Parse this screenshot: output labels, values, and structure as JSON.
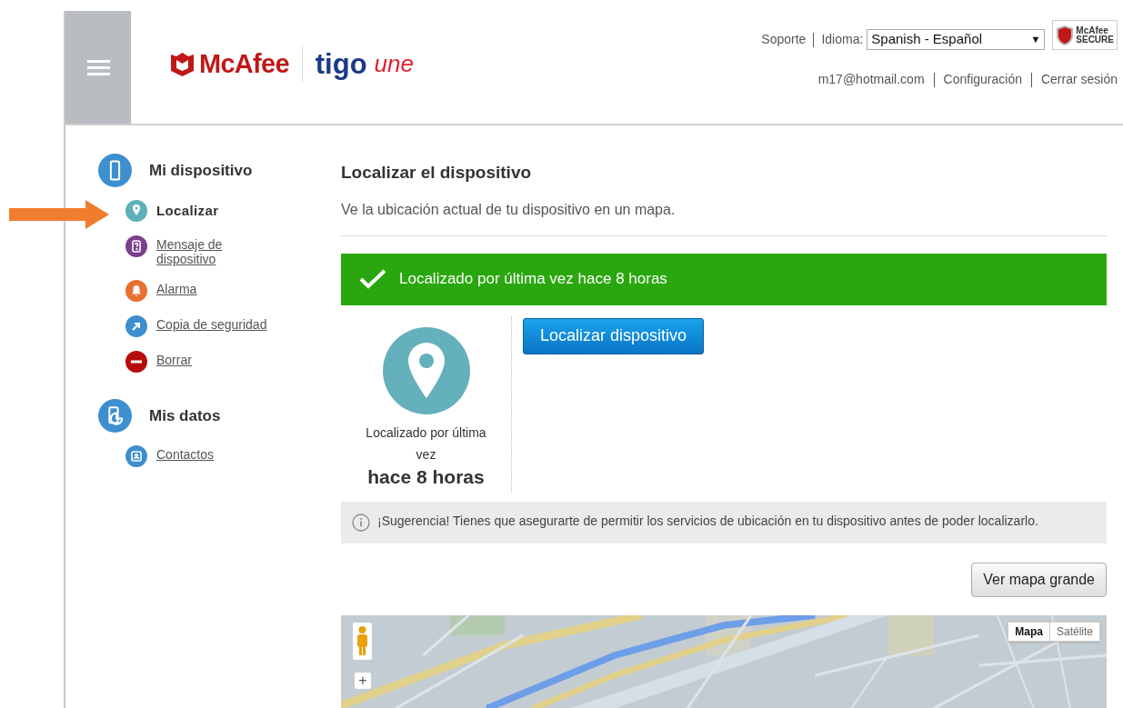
{
  "header": {
    "brand": {
      "mcafee": "McAfee",
      "tigo": "tigo",
      "une": "une"
    },
    "support_link": "Soporte",
    "language_label": "Idioma:",
    "language_select": {
      "value": "Spanish - Español",
      "arrow": "▼"
    },
    "secure_badge": {
      "line1": "McAfee",
      "line2": "SECURE"
    },
    "account_links": [
      "m17@hotmail.com",
      "Configuración",
      "Cerrar sesión"
    ]
  },
  "sidebar": {
    "groups": [
      {
        "title": "Mi dispositivo",
        "kind": "phone",
        "items": [
          {
            "label": "Localizar",
            "kind": "pin",
            "color": "#5eb0b9",
            "selected": true
          },
          {
            "label": "Mensaje de dispositivo",
            "kind": "question",
            "color": "#7b3f8c",
            "selected": false
          },
          {
            "label": "Alarma",
            "kind": "bell",
            "color": "#e8702e",
            "selected": false
          },
          {
            "label": "Copia de seguridad",
            "kind": "arrow",
            "color": "#3d8fcf",
            "selected": false
          },
          {
            "label": "Borrar",
            "kind": "minus",
            "color": "#b50d0d",
            "selected": false
          }
        ]
      },
      {
        "title": "Mis datos",
        "kind": "data",
        "items": [
          {
            "label": "Contactos",
            "kind": "contact",
            "color": "#3d8fcf",
            "selected": false
          }
        ]
      }
    ]
  },
  "main": {
    "title": "Localizar el dispositivo",
    "subtitle": "Ve la ubicación actual de tu dispositivo en un mapa.",
    "status_banner": "Localizado por última vez hace 8 horas",
    "last_located": {
      "caption": "Localizado por última vez",
      "time": "hace 8 horas"
    },
    "locate_button": "Localizar dispositivo",
    "tip": "¡Sugerencia! Tienes que asegurarte de permitir los servicios de ubicación en tu dispositivo antes de poder localizarlo.",
    "big_map_button": "Ver mapa grande",
    "map": {
      "zoom_in": "+",
      "map_types": [
        {
          "label": "Mapa",
          "selected": true
        },
        {
          "label": "Satélite",
          "selected": false
        }
      ]
    }
  }
}
